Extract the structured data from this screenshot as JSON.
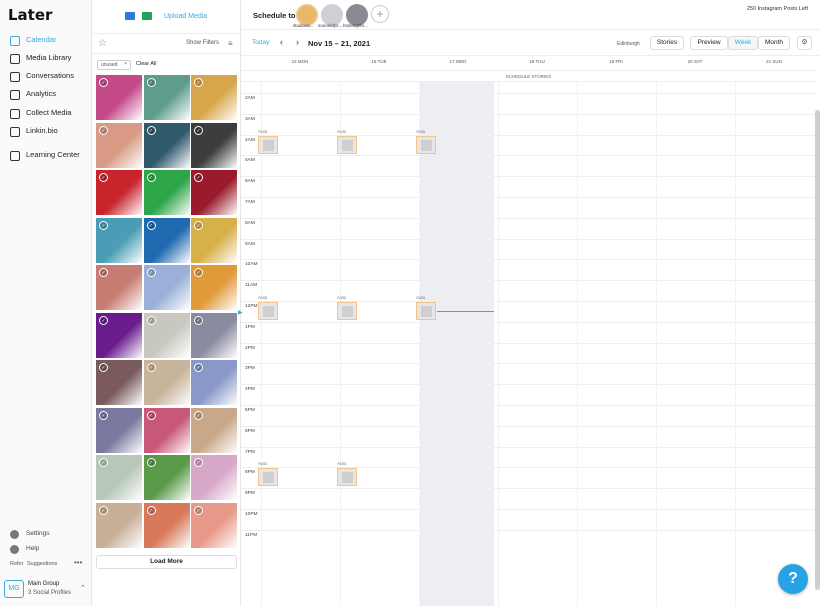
{
  "brand": {
    "logo": "Later",
    "accent": "#3da8d9"
  },
  "nav": [
    {
      "label": "Calendar",
      "icon": "calendar-icon"
    },
    {
      "label": "Media Library",
      "icon": "media-icon"
    },
    {
      "label": "Conversations",
      "icon": "chat-icon"
    },
    {
      "label": "Analytics",
      "icon": "chart-icon"
    },
    {
      "label": "Collect Media",
      "icon": "collect-icon"
    },
    {
      "label": "Linkin.bio",
      "icon": "link-icon"
    },
    {
      "label": "Learning Center",
      "icon": "learning-icon"
    }
  ],
  "bottom_nav": [
    {
      "label": "Settings",
      "icon": "gear-icon"
    },
    {
      "label": "Help",
      "icon": "help-icon"
    }
  ],
  "refer": {
    "label": "Refer",
    "suggestions": "Suggestions"
  },
  "group": {
    "initials": "MG",
    "name": "Main Group",
    "sub": "3 Social Profiles"
  },
  "media": {
    "upload_label": "Upload Media",
    "show_filters": "Show Filters",
    "filter_chip": "unused",
    "clear_all": "Clear All",
    "load_more": "Load More",
    "thumb_colors": [
      [
        "#c44a8a",
        "#5f9c8c",
        "#d7a64a"
      ],
      [
        "#d89a84",
        "#2f5a6c",
        "#3d3d3d"
      ],
      [
        "#c8242c",
        "#2ea548",
        "#9a1c2c"
      ],
      [
        "#4a9db5",
        "#1f6ab0",
        "#d8b04a"
      ],
      [
        "#c87d74",
        "#9ab0d8",
        "#e09a3a"
      ],
      [
        "#6a1c8c",
        "#c8c8c0",
        "#8a8aa0"
      ],
      [
        "#7a5a5c",
        "#c8b49a",
        "#8898c8"
      ],
      [
        "#7a7aa0",
        "#c85878",
        "#c8a888"
      ],
      [
        "#b8c8b8",
        "#5a9a48",
        "#d8a8c8"
      ],
      [
        "#c8b098",
        "#d87a5a",
        "#e89a8a"
      ]
    ]
  },
  "header": {
    "schedule_to": "Schedule to",
    "profiles": [
      "studiosa...",
      "sooonidyo...",
      "hrdesignfo..."
    ],
    "posts_left": "250 Instagram Posts Left"
  },
  "calendar": {
    "today": "Today",
    "range": "Nov 15 – 21, 2021",
    "timezone": "Edinburgh",
    "stories": "Stories",
    "preview": "Preview",
    "week": "Week",
    "month": "Month",
    "days": [
      "15 MON",
      "16 TUE",
      "17 WED",
      "18 THU",
      "19 FRI",
      "20 SAT",
      "21 SUN"
    ],
    "schedule_stories": "SCHEDULE STORIES",
    "hours": [
      "2AM",
      "3AM",
      "4AM",
      "5AM",
      "6AM",
      "7AM",
      "8AM",
      "9AM",
      "10AM",
      "11AM",
      "12PM",
      "1PM",
      "2PM",
      "3PM",
      "4PM",
      "5PM",
      "6PM",
      "7PM",
      "8PM",
      "9PM",
      "10PM",
      "11PM"
    ],
    "auto": "Auto",
    "posts": [
      {
        "day": 0,
        "time": "4AM"
      },
      {
        "day": 1,
        "time": "4AM"
      },
      {
        "day": 2,
        "time": "4AM"
      },
      {
        "day": 0,
        "time": "12PM"
      },
      {
        "day": 1,
        "time": "12PM"
      },
      {
        "day": 2,
        "time": "12PM"
      },
      {
        "day": 0,
        "time": "8PM"
      },
      {
        "day": 1,
        "time": "8PM"
      }
    ]
  }
}
